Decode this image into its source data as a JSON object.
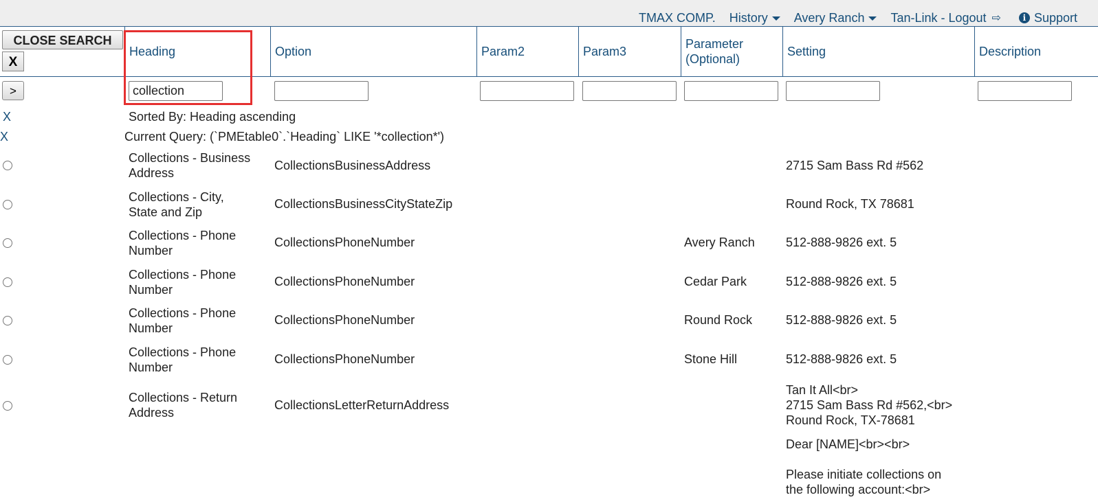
{
  "topnav": {
    "company": "TMAX COMP.",
    "history": "History",
    "location": "Avery Ranch",
    "logout": "Tan-Link - Logout",
    "support": "Support"
  },
  "buttons": {
    "close_search": "CLOSE SEARCH",
    "x": "X",
    "go": ">"
  },
  "columns": [
    "Heading",
    "Option",
    "Param2",
    "Param3",
    "Parameter (Optional)",
    "Setting",
    "Description"
  ],
  "filter": {
    "heading_value": "collection"
  },
  "sorted_by": "Sorted By: Heading ascending",
  "current_query": "Current Query: (`PMEtable0`.`Heading` LIKE '*collection*')",
  "clear_x": "X",
  "rows": [
    {
      "heading": "Collections - Business Address",
      "option": "CollectionsBusinessAddress",
      "param": "",
      "setting": "2715 Sam Bass Rd #562"
    },
    {
      "heading": "Collections - City, State and Zip",
      "option": "CollectionsBusinessCityStateZip",
      "param": "",
      "setting": "Round Rock, TX 78681"
    },
    {
      "heading": "Collections - Phone Number",
      "option": "CollectionsPhoneNumber",
      "param": "Avery Ranch",
      "setting": "512-888-9826 ext. 5"
    },
    {
      "heading": "Collections - Phone Number",
      "option": "CollectionsPhoneNumber",
      "param": "Cedar Park",
      "setting": "512-888-9826 ext. 5"
    },
    {
      "heading": "Collections - Phone Number",
      "option": "CollectionsPhoneNumber",
      "param": "Round Rock",
      "setting": "512-888-9826 ext. 5"
    },
    {
      "heading": "Collections - Phone Number",
      "option": "CollectionsPhoneNumber",
      "param": "Stone Hill",
      "setting": "512-888-9826 ext. 5"
    },
    {
      "heading": "Collections - Return Address",
      "option": "CollectionsLetterReturnAddress",
      "param": "",
      "setting": "Tan It All<br>\n2715 Sam Bass Rd #562,<br>\nRound Rock, TX-78681"
    }
  ],
  "partial_setting": "Dear [NAME]<br><br>\n\nPlease initiate collections on\nthe following account:<br>"
}
